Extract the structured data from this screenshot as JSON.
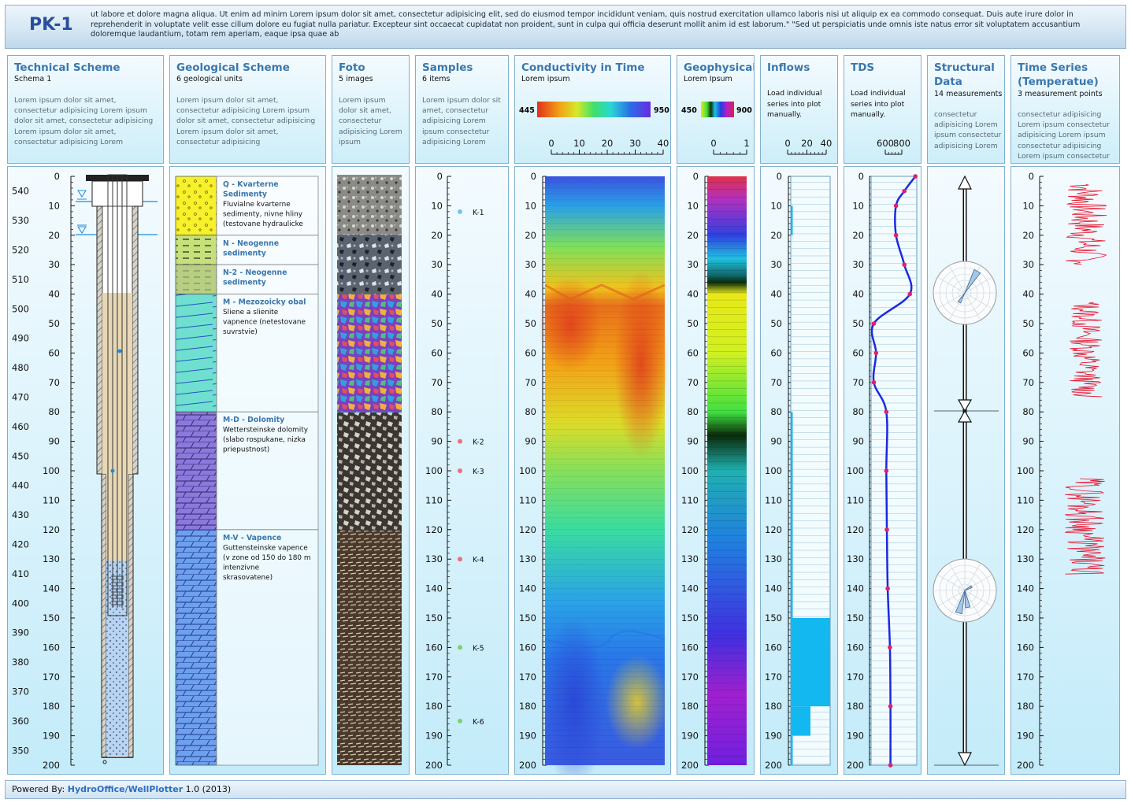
{
  "well_id": "PK-1",
  "description": "ut labore et dolore magna aliqua. Ut enim ad minim Lorem ipsum dolor sit amet, consectetur adipisicing elit, sed do eiusmod tempor incididunt veniam, quis nostrud exercitation ullamco laboris nisi ut aliquip ex ea commodo consequat. Duis aute irure dolor in reprehenderit in voluptate velit esse cillum dolore eu fugiat nulla pariatur. Excepteur sint occaecat cupidatat non proident, sunt in culpa qui officia deserunt mollit anim id est laborum.\" \"Sed ut perspiciatis unde omnis iste natus error sit voluptatem accusantium doloremque laudantium, totam rem aperiam, eaque ipsa quae ab",
  "panels": {
    "technical": {
      "title": "Technical Scheme",
      "subtitle": "Schema 1",
      "desc": "Lorem ipsum dolor sit amet, consectetur adipisicing Lorem ipsum dolor sit amet, consectetur adipisicing Lorem ipsum dolor sit amet, consectetur adipisicing Lorem"
    },
    "geological": {
      "title": "Geological Scheme",
      "subtitle": "6 geological units",
      "desc": "Lorem ipsum dolor sit amet, consectetur adipisicing Lorem ipsum dolor sit amet, consectetur adipisicing Lorem ipsum dolor sit amet, consectetur adipisicing"
    },
    "foto": {
      "title": "Foto",
      "subtitle": "5 images",
      "desc": "Lorem ipsum dolor sit amet, consectetur adipisicing Lorem ipsum"
    },
    "samples": {
      "title": "Samples",
      "subtitle": "6 items",
      "desc": "Lorem ipsum dolor sit amet, consectetur adipisicing Lorem ipsum consectetur adipisicing Lorem"
    },
    "conductivity": {
      "title": "Conductivity in Time",
      "subtitle": "Lorem ipsum",
      "scale_min": "445",
      "scale_max": "950",
      "ticks": [
        "0",
        "10",
        "20",
        "30",
        "40"
      ]
    },
    "geophysical": {
      "title": "Geophysical",
      "subtitle": "Lorem Ipsum",
      "scale_min": "450",
      "scale_max": "900",
      "ticks": [
        "0",
        "1"
      ]
    },
    "inflows": {
      "title": "Inflows",
      "note": "Load individual series into plot manually.",
      "ticks": [
        "0",
        "20",
        "40"
      ]
    },
    "tds": {
      "title": "TDS",
      "note": "Load individual series into plot manually.",
      "ticks": [
        "600",
        "800"
      ]
    },
    "structural": {
      "title_line1": "Structural",
      "title_line2": "Data",
      "subtitle": "14 measurements",
      "desc": "consectetur adipisicing Lorem ipsum consectetur adipisicing Lorem"
    },
    "timeseries": {
      "title_line1": "Time Series",
      "title_line2": "(Temperatue)",
      "subtitle": "3 measurement points",
      "desc": "consectetur adipisicing Lorem ipsum consectetur adipisicing Lorem ipsum consectetur adipisicing Lorem ipsum consectetur"
    }
  },
  "depth_ticks": [
    "0",
    "10",
    "20",
    "30",
    "40",
    "50",
    "60",
    "70",
    "80",
    "90",
    "100",
    "110",
    "120",
    "130",
    "140",
    "150",
    "160",
    "170",
    "180",
    "190",
    "200"
  ],
  "elevation_ticks": [
    "540",
    "530",
    "520",
    "510",
    "500",
    "490",
    "480",
    "470",
    "460",
    "450",
    "440",
    "430",
    "420",
    "410",
    "400",
    "390",
    "380",
    "370",
    "360",
    "350"
  ],
  "geo_units": [
    {
      "name": "Q - Kvarterne Sedimenty",
      "desc": "Fluvialne kvarterne sedimenty, nivne hliny (testovane hydraulicke",
      "from": 0,
      "to": 20,
      "color": "#f6f12a"
    },
    {
      "name": "N - Neogenne sedimenty",
      "desc": "",
      "from": 20,
      "to": 30,
      "color": "#c6e07a"
    },
    {
      "name": "N-2 - Neogenne sedimenty",
      "desc": "",
      "from": 30,
      "to": 40,
      "color": "#b6cf82"
    },
    {
      "name": "M - Mezozoicky obal",
      "desc": "Sliene a slienite vapnence (netestovane suvrstvie)",
      "from": 40,
      "to": 80,
      "color": "#6fe0cf"
    },
    {
      "name": "M-D - Dolomity",
      "desc": "Wettersteinske dolomity (slabo rospukane, nizka priepustnost)",
      "from": 80,
      "to": 120,
      "color": "#8d78dc"
    },
    {
      "name": "M-V - Vapence",
      "desc": "Guttensteinske vapence (v zone od 150 do 180 m intenzivne skrasovatene)",
      "from": 120,
      "to": 200,
      "color": "#6fa0ee"
    }
  ],
  "samples": [
    {
      "label": "K-1",
      "depth": 12,
      "color": "#6ec5ee"
    },
    {
      "label": "K-2",
      "depth": 90,
      "color": "#ef6f7a"
    },
    {
      "label": "K-3",
      "depth": 100,
      "color": "#ef6f7a"
    },
    {
      "label": "K-4",
      "depth": 130,
      "color": "#ef6f7a"
    },
    {
      "label": "K-5",
      "depth": 160,
      "color": "#7fcf6f"
    },
    {
      "label": "K-6",
      "depth": 185,
      "color": "#7fcf6f"
    }
  ],
  "inflows_data": [
    {
      "from": 10,
      "to": 20,
      "value": 2
    },
    {
      "from": 80,
      "to": 150,
      "value": 2
    },
    {
      "from": 150,
      "to": 180,
      "value": 40
    },
    {
      "from": 180,
      "to": 190,
      "value": 20
    },
    {
      "from": 190,
      "to": 200,
      "value": 2
    }
  ],
  "tds_data": [
    {
      "depth": 0,
      "value": 900
    },
    {
      "depth": 5,
      "value": 860
    },
    {
      "depth": 10,
      "value": 830
    },
    {
      "depth": 20,
      "value": 830
    },
    {
      "depth": 30,
      "value": 860
    },
    {
      "depth": 40,
      "value": 880
    },
    {
      "depth": 50,
      "value": 750
    },
    {
      "depth": 60,
      "value": 758
    },
    {
      "depth": 70,
      "value": 750
    },
    {
      "depth": 80,
      "value": 795
    },
    {
      "depth": 100,
      "value": 795
    },
    {
      "depth": 120,
      "value": 797
    },
    {
      "depth": 140,
      "value": 800
    },
    {
      "depth": 160,
      "value": 808
    },
    {
      "depth": 180,
      "value": 810
    },
    {
      "depth": 200,
      "value": 810
    }
  ],
  "footer": {
    "prefix": "Powered By: ",
    "link": "HydroOffice/WellPlotter",
    "suffix": " 1.0 (2013)"
  },
  "colors": {
    "accent": "#3b77ad",
    "title": "#2a4f9a",
    "border": "#7fb1cf"
  }
}
